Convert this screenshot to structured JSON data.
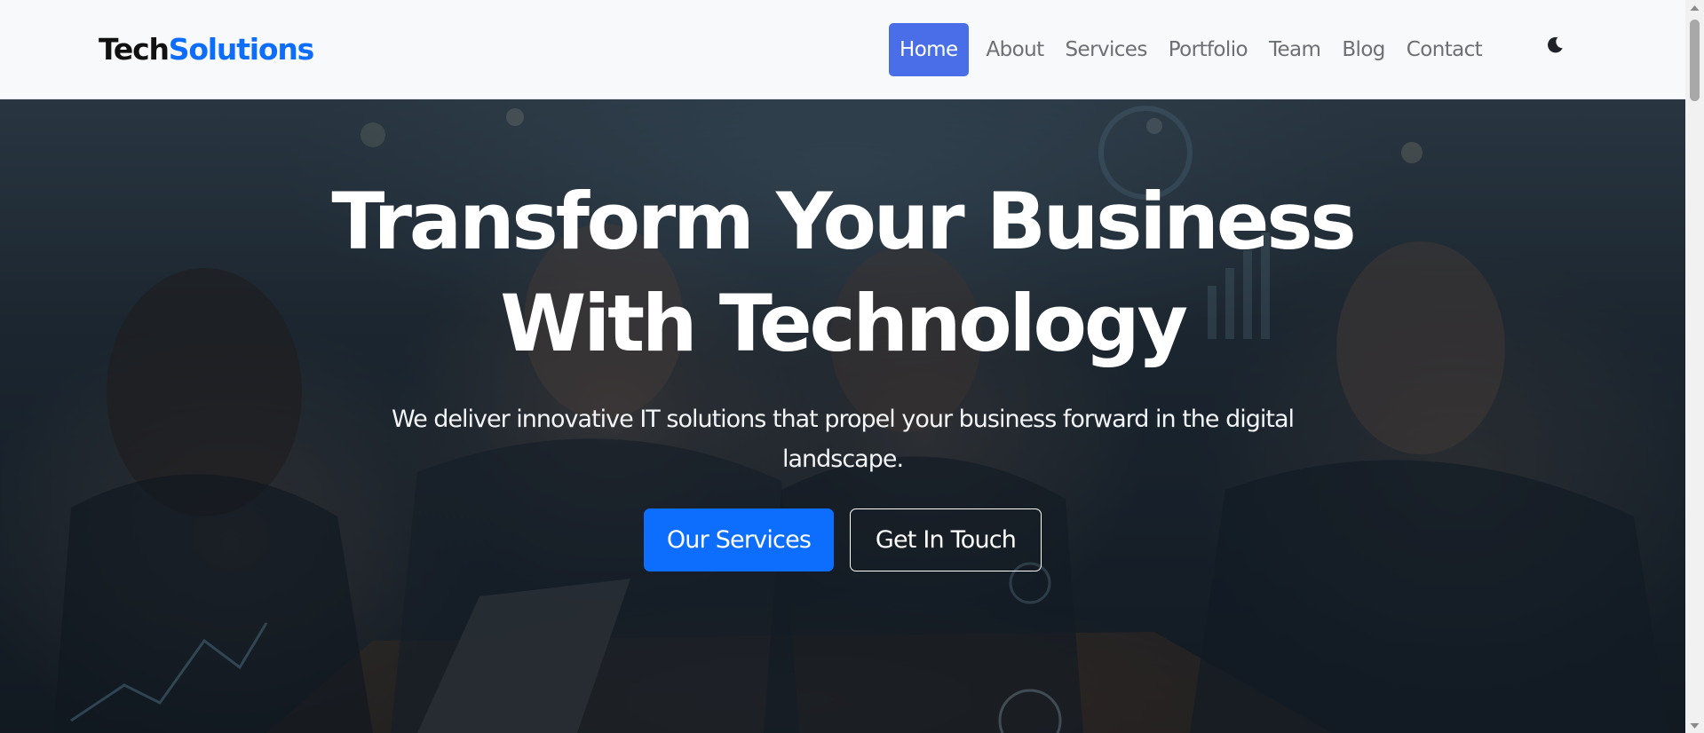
{
  "brand": {
    "part1": "Tech",
    "part2": "Solutions"
  },
  "nav": {
    "items": [
      {
        "label": "Home",
        "active": true
      },
      {
        "label": "About",
        "active": false
      },
      {
        "label": "Services",
        "active": false
      },
      {
        "label": "Portfolio",
        "active": false
      },
      {
        "label": "Team",
        "active": false
      },
      {
        "label": "Blog",
        "active": false
      },
      {
        "label": "Contact",
        "active": false
      }
    ],
    "theme_toggle_icon": "moon-icon"
  },
  "hero": {
    "title_line1": "Transform Your Business",
    "title_line2": "With Technology",
    "subtitle": "We deliver innovative IT solutions that propel your business forward in the digital landscape.",
    "primary_button": "Our Services",
    "secondary_button": "Get In Touch",
    "background_description_icon": "office-team-photo"
  },
  "colors": {
    "accent": "#0d6efd",
    "nav_active": "#4a6ee8",
    "navbar_bg": "#f8f9fa",
    "nav_text": "#6c6f73"
  }
}
